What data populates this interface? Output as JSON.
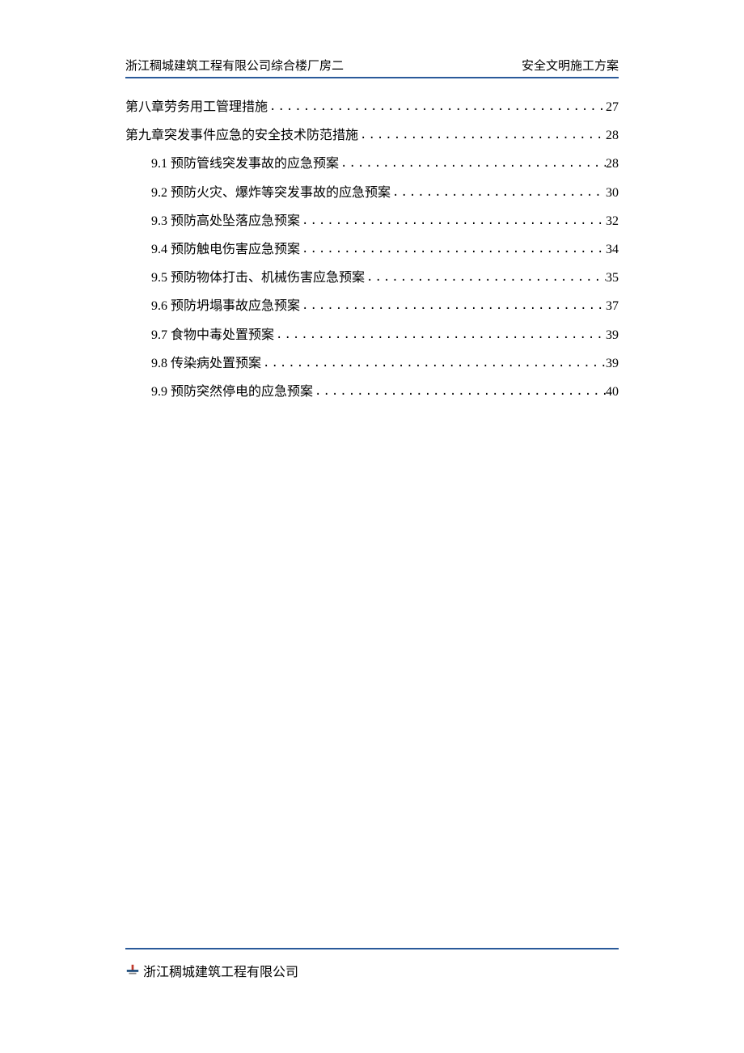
{
  "header": {
    "left": "浙江稠城建筑工程有限公司综合楼厂房二",
    "right": "安全文明施工方案"
  },
  "toc": [
    {
      "level": 0,
      "title": "第八章劳务用工管理措施",
      "page": "27"
    },
    {
      "level": 0,
      "title": "第九章突发事件应急的安全技术防范措施",
      "page": "28"
    },
    {
      "level": 1,
      "title": "9.1 预防管线突发事故的应急预案",
      "page": "28"
    },
    {
      "level": 1,
      "title": "9.2 预防火灾、爆炸等突发事故的应急预案",
      "page": "30"
    },
    {
      "level": 1,
      "title": "9.3 预防高处坠落应急预案",
      "page": "32"
    },
    {
      "level": 1,
      "title": "9.4 预防触电伤害应急预案",
      "page": "34"
    },
    {
      "level": 1,
      "title": "9.5 预防物体打击、机械伤害应急预案",
      "page": "35"
    },
    {
      "level": 1,
      "title": "9.6 预防坍塌事故应急预案",
      "page": "37"
    },
    {
      "level": 1,
      "title": "9.7 食物中毒处置预案",
      "page": "39"
    },
    {
      "level": 1,
      "title": "9.8 传染病处置预案",
      "page": "39"
    },
    {
      "level": 1,
      "title": "9.9 预防突然停电的应急预案",
      "page": "40"
    }
  ],
  "footer": {
    "company": "浙江稠城建筑工程有限公司"
  }
}
